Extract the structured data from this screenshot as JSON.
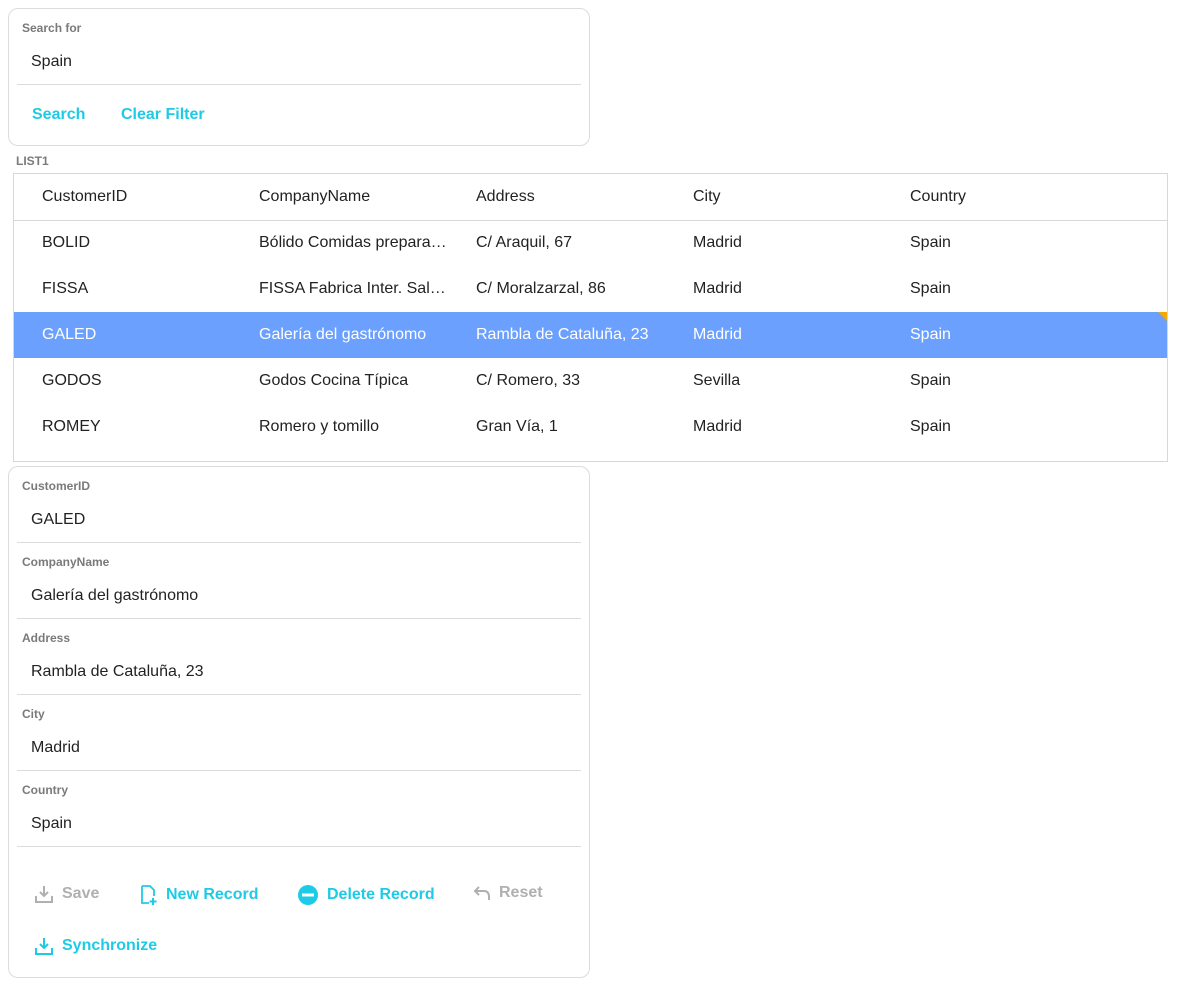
{
  "search": {
    "label": "Search for",
    "value": "Spain",
    "search_button": "Search",
    "clear_button": "Clear Filter"
  },
  "list": {
    "label": "LIST1",
    "columns": [
      "CustomerID",
      "CompanyName",
      "Address",
      "City",
      "Country"
    ],
    "rows": [
      [
        "BOLID",
        "Bólido Comidas preparadas",
        "C/ Araquil, 67",
        "Madrid",
        "Spain"
      ],
      [
        "FISSA",
        "FISSA Fabrica Inter. Salchichas S.A.",
        "C/ Moralzarzal, 86",
        "Madrid",
        "Spain"
      ],
      [
        "GALED",
        "Galería del gastrónomo",
        "Rambla de Cataluña, 23",
        "Madrid",
        "Spain"
      ],
      [
        "GODOS",
        "Godos Cocina Típica",
        "C/ Romero, 33",
        "Sevilla",
        "Spain"
      ],
      [
        "ROMEY",
        "Romero y tomillo",
        "Gran Vía, 1",
        "Madrid",
        "Spain"
      ]
    ],
    "selected_index": 2
  },
  "detail": {
    "fields": [
      {
        "label": "CustomerID",
        "value": "GALED"
      },
      {
        "label": "CompanyName",
        "value": "Galería del gastrónomo"
      },
      {
        "label": "Address",
        "value": "Rambla de Cataluña, 23"
      },
      {
        "label": "City",
        "value": "Madrid"
      },
      {
        "label": "Country",
        "value": "Spain"
      }
    ],
    "actions": {
      "save": "Save",
      "new_record": "New Record",
      "delete_record": "Delete Record",
      "reset": "Reset",
      "synchronize": "Synchronize"
    }
  },
  "colors": {
    "accent": "#1ecbe6",
    "selected_row": "#6ba0ff",
    "disabled": "#b0b0b0",
    "marker": "#f6a800"
  },
  "icons": {
    "save": "save-download-icon",
    "new_record": "new-document-icon",
    "delete_record": "minus-circle-icon",
    "reset": "undo-arrow-icon",
    "synchronize": "sync-download-icon"
  }
}
